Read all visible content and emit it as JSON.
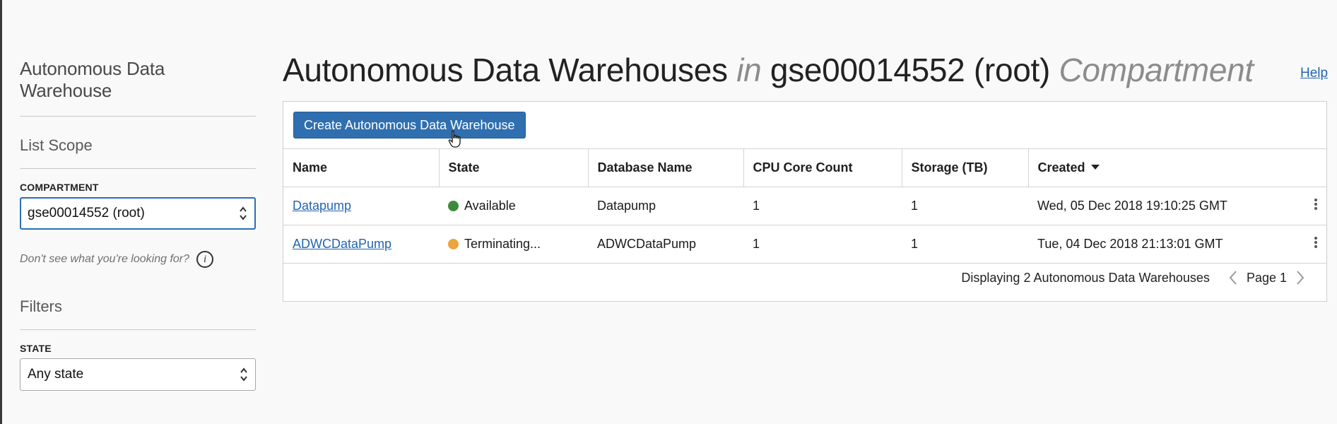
{
  "sidebar": {
    "title": "Autonomous Data Warehouse",
    "list_scope": "List Scope",
    "compartment_label": "COMPARTMENT",
    "compartment_value": "gse00014552 (root)",
    "hint": "Don't see what you're looking for?",
    "filters": "Filters",
    "state_label": "STATE",
    "state_value": "Any state"
  },
  "header": {
    "title_part1": "Autonomous Data Warehouses",
    "title_in": "in",
    "title_part2": "gse00014552 (root)",
    "title_part3": "Compartment",
    "help": "Help"
  },
  "toolbar": {
    "create_label": "Create Autonomous Data Warehouse"
  },
  "table": {
    "columns": [
      "Name",
      "State",
      "Database Name",
      "CPU Core Count",
      "Storage (TB)",
      "Created"
    ],
    "rows": [
      {
        "name": "Datapump",
        "state": "Available",
        "state_color": "#3d8a3a",
        "db_name": "Datapump",
        "cpu": "1",
        "storage": "1",
        "created": "Wed, 05 Dec 2018 19:10:25 GMT"
      },
      {
        "name": "ADWCDataPump",
        "state": "Terminating...",
        "state_color": "#eaa53c",
        "db_name": "ADWCDataPump",
        "cpu": "1",
        "storage": "1",
        "created": "Tue, 04 Dec 2018 21:13:01 GMT"
      }
    ]
  },
  "footer": {
    "display_text": "Displaying 2 Autonomous Data Warehouses",
    "page_label": "Page 1"
  },
  "colors": {
    "primary_button": "#2f6fb0",
    "link": "#2264b0",
    "available": "#3d8a3a",
    "terminating": "#eaa53c"
  }
}
